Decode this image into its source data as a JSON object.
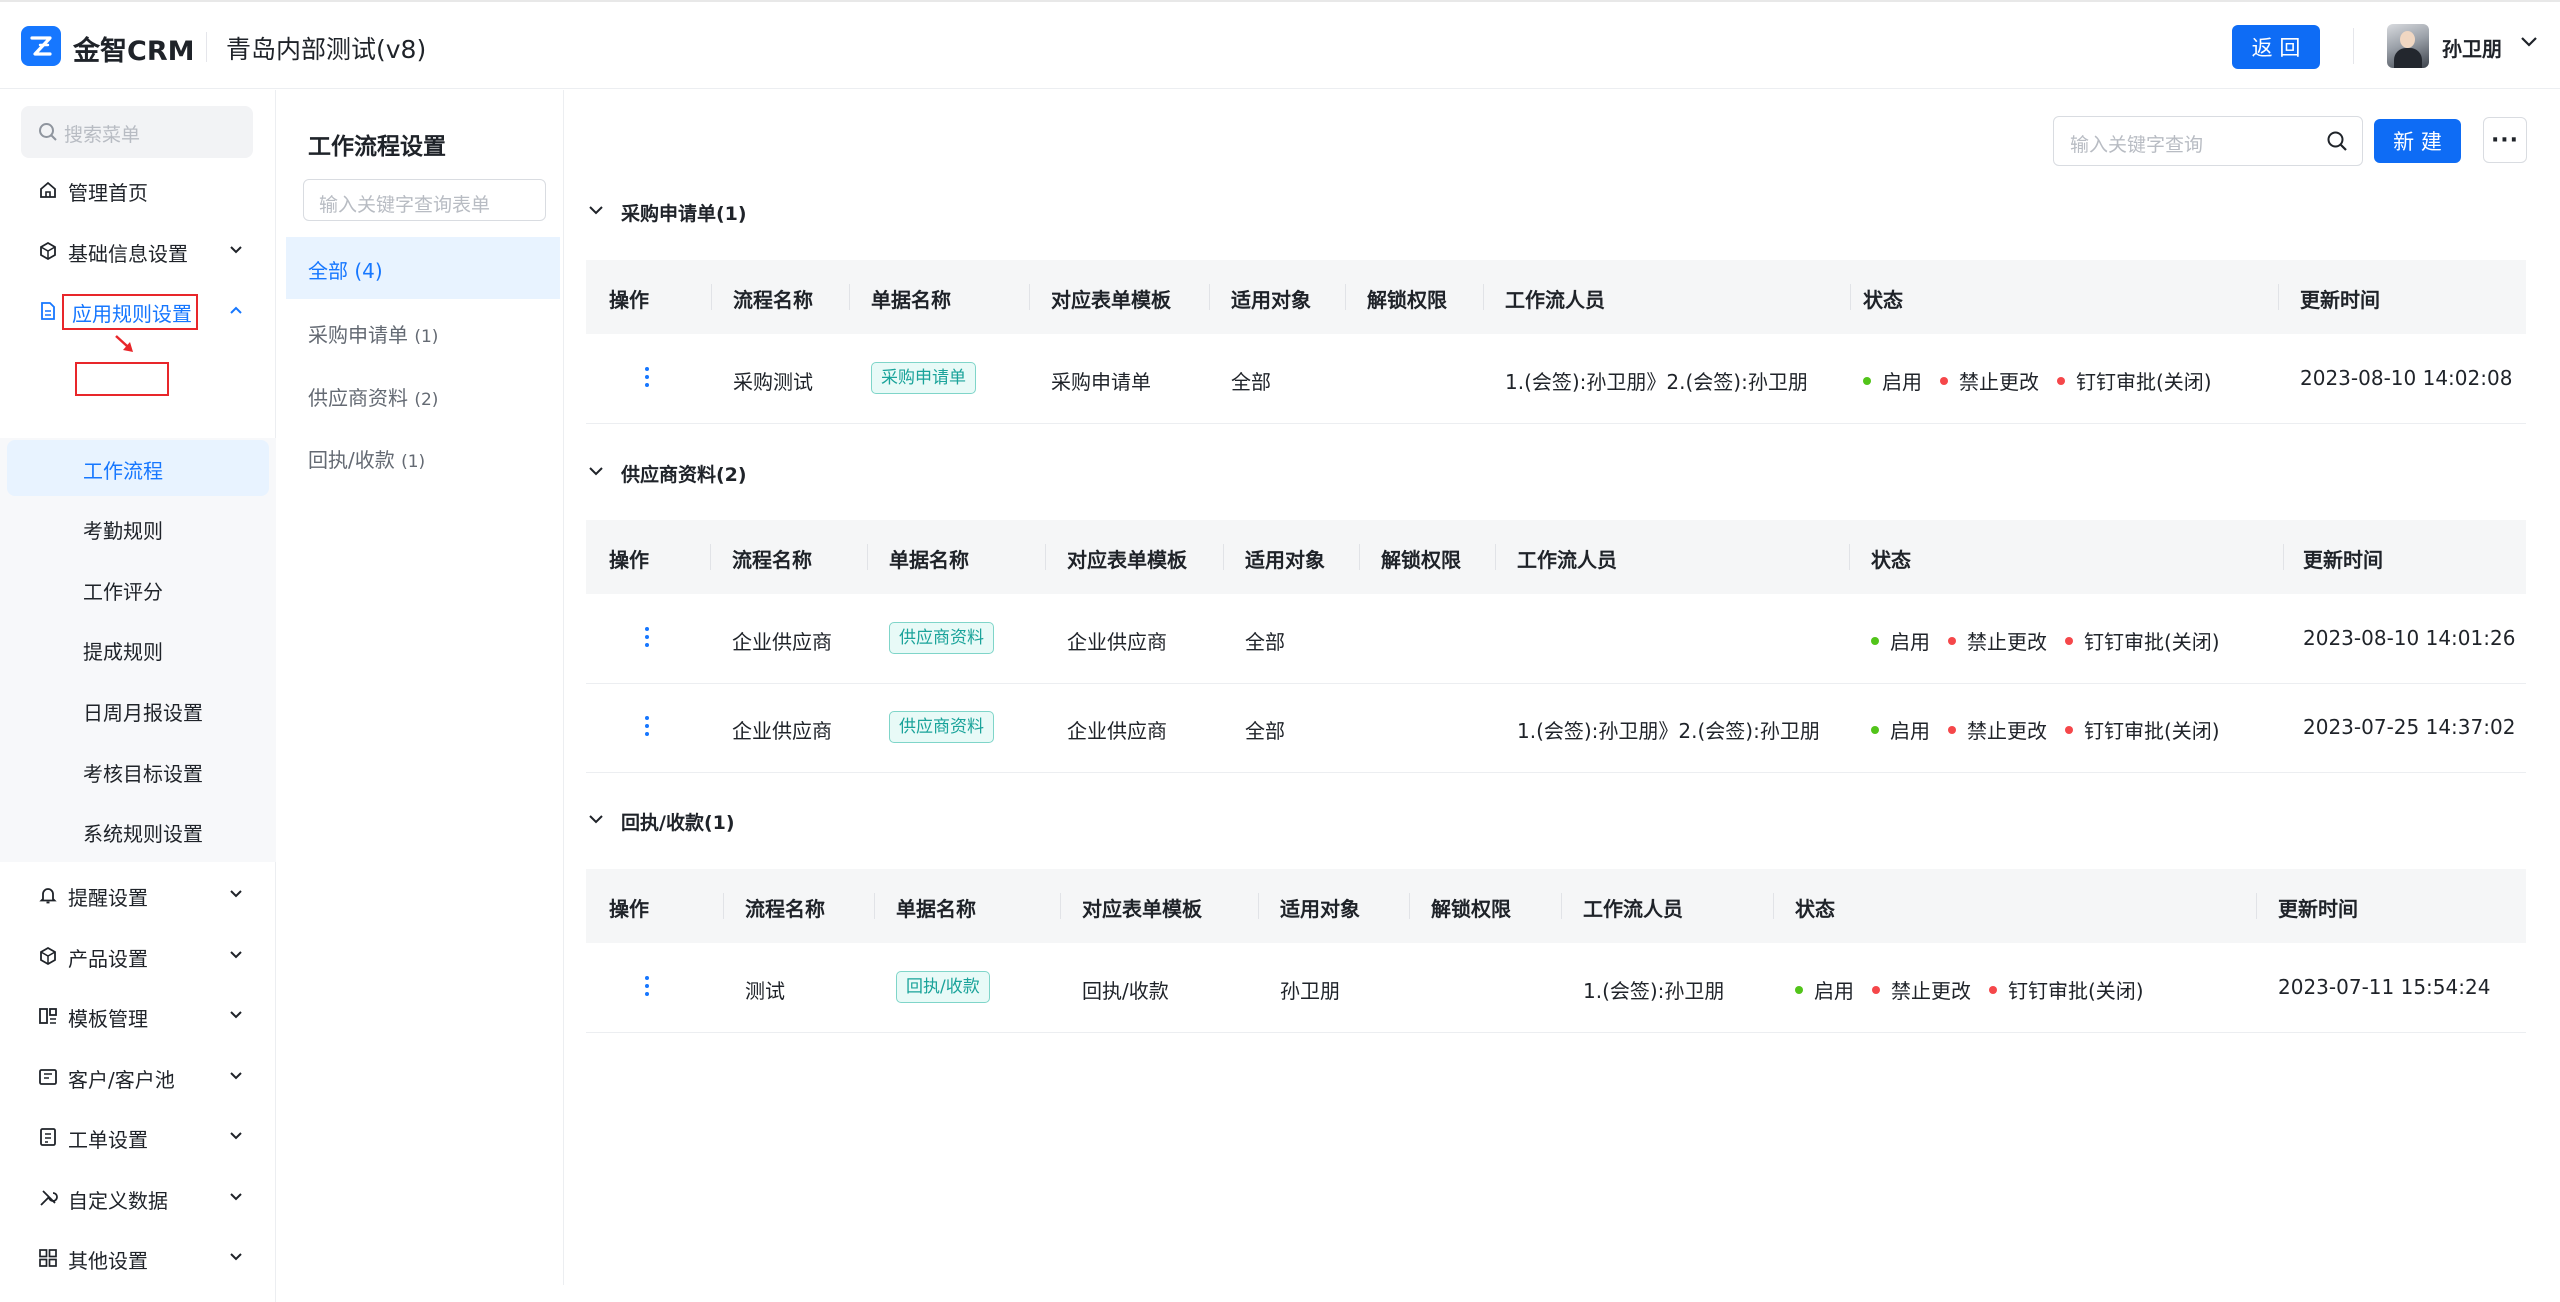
{
  "header": {
    "brand": "金智CRM",
    "project": "青岛内部测试(v8)",
    "back_label": "返 回",
    "user_name": "孙卫朋"
  },
  "sidebar": {
    "search_placeholder": "搜索菜单",
    "items": [
      {
        "label": "管理首页",
        "icon": "home-icon"
      },
      {
        "label": "基础信息设置",
        "icon": "cube-icon"
      },
      {
        "label": "应用规则设置",
        "icon": "document-icon"
      },
      {
        "label": "提醒设置",
        "icon": "bell-icon"
      },
      {
        "label": "产品设置",
        "icon": "cube-icon"
      },
      {
        "label": "模板管理",
        "icon": "template-icon"
      },
      {
        "label": "客户/客户池",
        "icon": "customer-icon"
      },
      {
        "label": "工单设置",
        "icon": "ticket-icon"
      },
      {
        "label": "自定义数据",
        "icon": "tools-icon"
      },
      {
        "label": "其他设置",
        "icon": "grid-icon"
      }
    ],
    "sub_items": [
      "工作流程",
      "考勤规则",
      "工作评分",
      "提成规则",
      "日周月报设置",
      "考核目标设置",
      "系统规则设置"
    ]
  },
  "main": {
    "page_title": "工作流程设置",
    "form_search_placeholder": "输入关键字查询表单",
    "keyword_placeholder": "输入关键字查询",
    "new_label": "新 建",
    "more_label": "···",
    "categories": [
      {
        "name": "全部",
        "count": "(4)"
      },
      {
        "name": "采购申请单",
        "count": "(1)"
      },
      {
        "name": "供应商资料",
        "count": "(2)"
      },
      {
        "name": "回执/收款",
        "count": "(1)"
      }
    ],
    "columns": [
      "操作",
      "流程名称",
      "单据名称",
      "对应表单模板",
      "适用对象",
      "解锁权限",
      "工作流人员",
      "状态",
      "更新时间"
    ],
    "status_labels": [
      "启用",
      "禁止更改",
      "钉钉审批(关闭)"
    ],
    "sections": [
      {
        "title": "采购申请单(1)",
        "rows": [
          {
            "flow": "采购测试",
            "doc": "采购申请单",
            "template": "采购申请单",
            "target": "全部",
            "unlock": "",
            "people": "1.(会签):孙卫朋》2.(会签):孙卫朋",
            "time": "2023-08-10 14:02:08"
          }
        ]
      },
      {
        "title": "供应商资料(2)",
        "rows": [
          {
            "flow": "企业供应商",
            "doc": "供应商资料",
            "template": "企业供应商",
            "target": "全部",
            "unlock": "",
            "people": "",
            "time": "2023-08-10 14:01:26"
          },
          {
            "flow": "企业供应商",
            "doc": "供应商资料",
            "template": "企业供应商",
            "target": "全部",
            "unlock": "",
            "people": "1.(会签):孙卫朋》2.(会签):孙卫朋",
            "time": "2023-07-25 14:37:02"
          }
        ]
      },
      {
        "title": "回执/收款(1)",
        "rows": [
          {
            "flow": "测试",
            "doc": "回执/收款",
            "template": "回执/收款",
            "target": "孙卫朋",
            "unlock": "",
            "people": "1.(会签):孙卫朋",
            "time": "2023-07-11 15:54:24"
          }
        ]
      }
    ]
  },
  "colors": {
    "primary": "#0e6cf5",
    "status_on": "#52c41a",
    "status_off": "#f5474a",
    "tag_text": "#1aa39a",
    "annotation_red": "#e8262a"
  }
}
